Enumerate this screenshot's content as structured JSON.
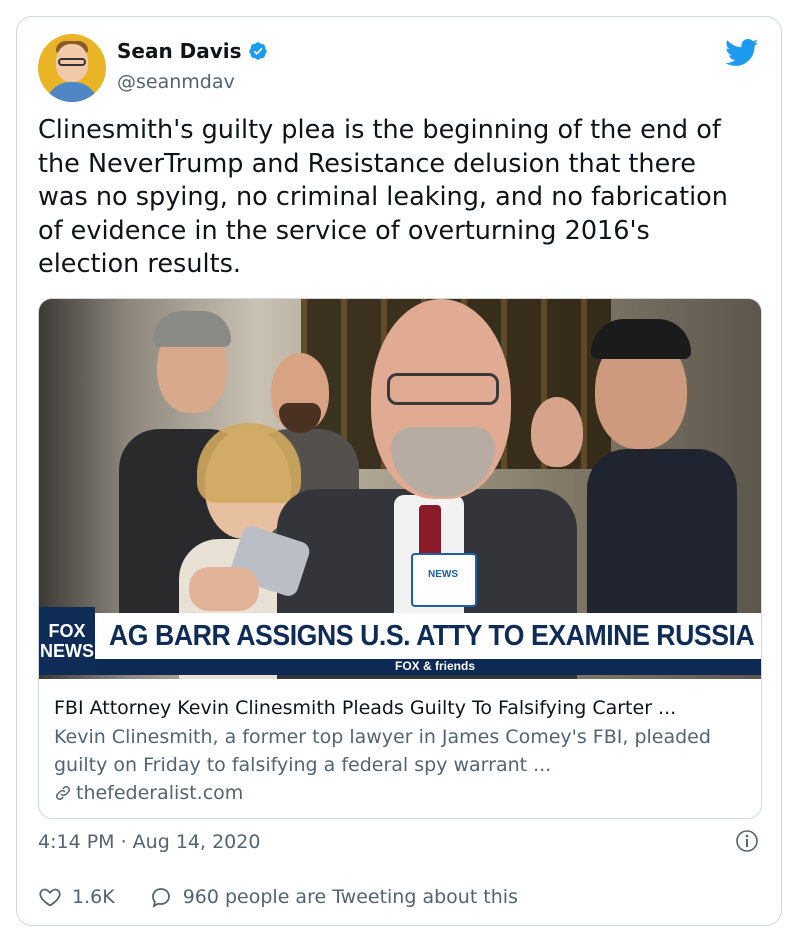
{
  "author": {
    "name": "Sean Davis",
    "handle": "@seanmdav",
    "verified": true
  },
  "tweet": {
    "text": "Clinesmith's guilty plea is the beginning of the end of\nthe NeverTrump and Resistance delusion that there\nwas no spying, no criminal leaking, and no fabrication\nof evidence in the service of overturning 2016's\nelection results."
  },
  "link_card": {
    "image": {
      "logo_text": "FOX\nNEWS",
      "headline": "AG BARR ASSIGNS U.S. ATTY TO EXAMINE RUSSIA PROB",
      "sub_label": "FOX & friends",
      "mic_label": "NEWS"
    },
    "title": "FBI Attorney Kevin Clinesmith Pleads Guilty To Falsifying Carter ...",
    "description": "Kevin Clinesmith, a former top lawyer in James Comey's FBI, pleaded guilty on Friday to falsifying a federal spy warrant ...",
    "domain": "thefederalist.com"
  },
  "meta": {
    "timestamp": "4:14 PM · Aug 14, 2020"
  },
  "actions": {
    "likes": "1.6K",
    "discussion": "960 people are Tweeting about this"
  },
  "colors": {
    "twitter_blue": "#1d9bf0",
    "text_primary": "#0f1419",
    "text_secondary": "#536471",
    "fox_navy": "#0f2c57"
  }
}
